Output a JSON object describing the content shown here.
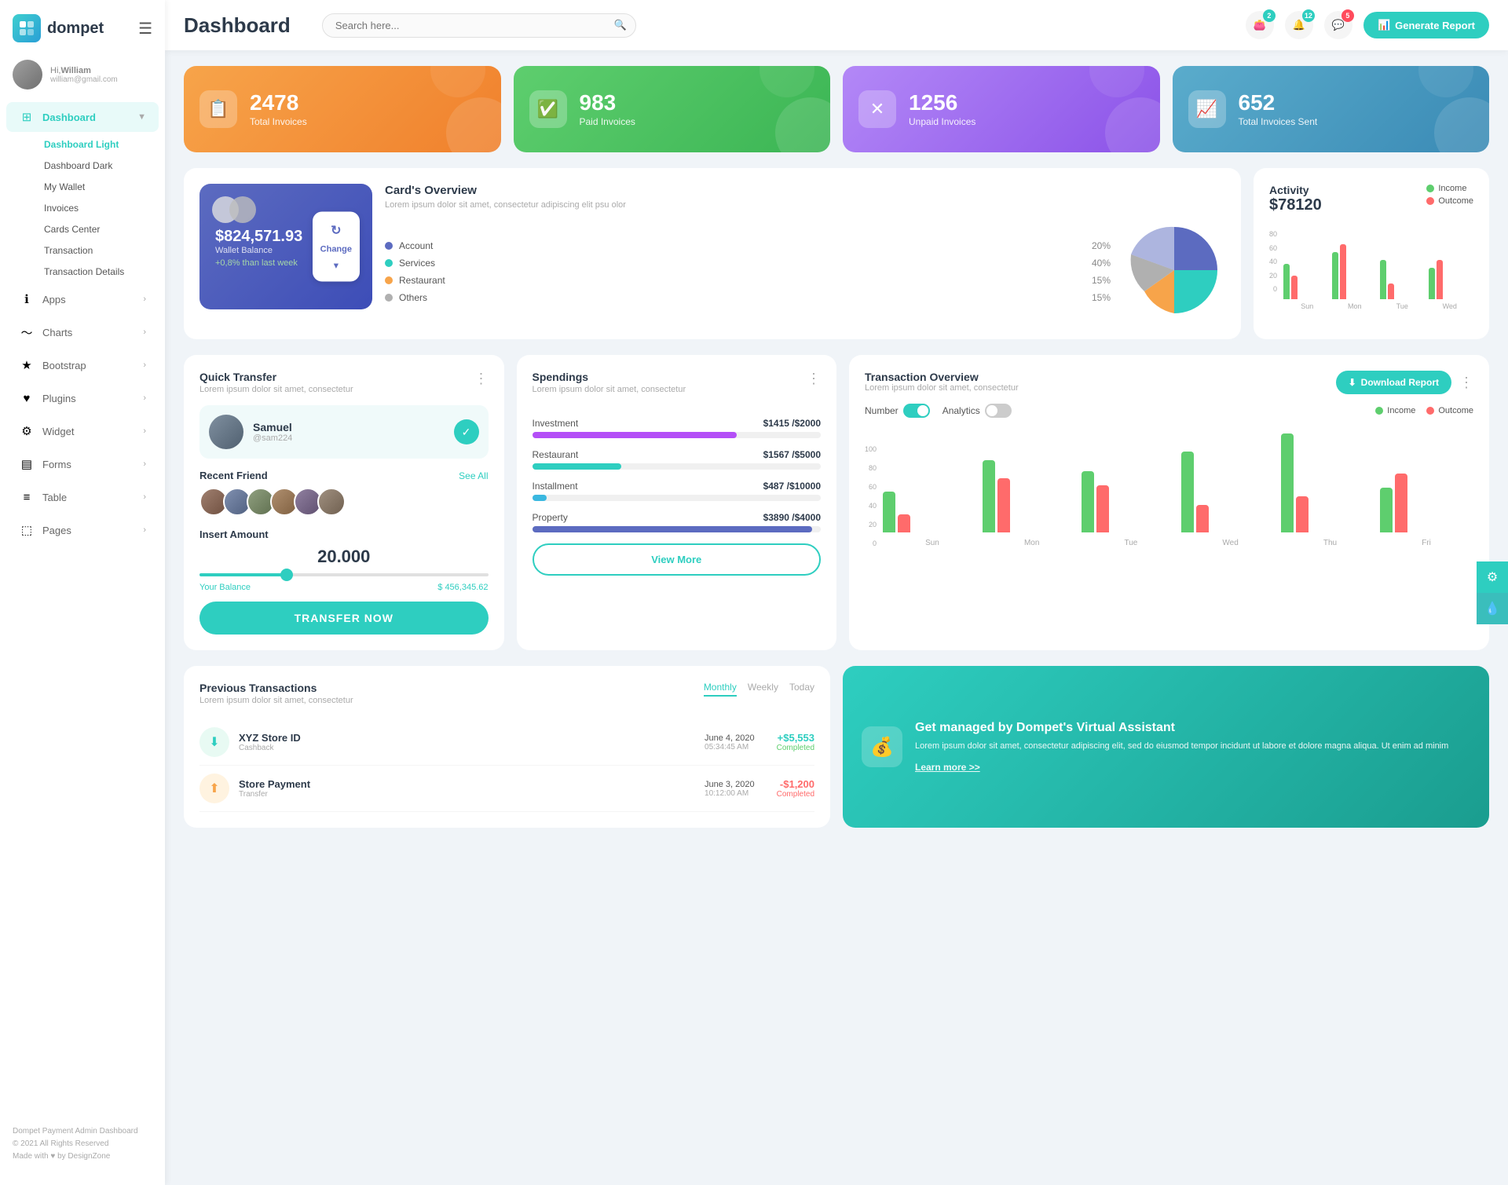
{
  "app": {
    "name": "dompet",
    "title": "Dashboard"
  },
  "header": {
    "search_placeholder": "Search here...",
    "generate_btn": "Generate Report",
    "notifications": {
      "wallet_count": "2",
      "bell_count": "12",
      "chat_count": "5"
    }
  },
  "user": {
    "greeting": "Hi,",
    "name": "William",
    "email": "william@gmail.com"
  },
  "sidebar": {
    "nav_items": [
      {
        "id": "dashboard",
        "label": "Dashboard",
        "icon": "⊞",
        "active": true,
        "has_arrow": true
      },
      {
        "id": "apps",
        "label": "Apps",
        "icon": "ℹ",
        "has_arrow": true
      },
      {
        "id": "charts",
        "label": "Charts",
        "icon": "〜",
        "has_arrow": true
      },
      {
        "id": "bootstrap",
        "label": "Bootstrap",
        "icon": "★",
        "has_arrow": true
      },
      {
        "id": "plugins",
        "label": "Plugins",
        "icon": "♥",
        "has_arrow": true
      },
      {
        "id": "widget",
        "label": "Widget",
        "icon": "⚙",
        "has_arrow": true
      },
      {
        "id": "forms",
        "label": "Forms",
        "icon": "▤",
        "has_arrow": true
      },
      {
        "id": "table",
        "label": "Table",
        "icon": "≡",
        "has_arrow": true
      },
      {
        "id": "pages",
        "label": "Pages",
        "icon": "⬚",
        "has_arrow": true
      }
    ],
    "sub_items": [
      "Dashboard Light",
      "Dashboard Dark",
      "My Wallet",
      "Invoices",
      "Cards Center",
      "Transaction",
      "Transaction Details"
    ],
    "footer_title": "Dompet Payment Admin Dashboard",
    "footer_copy": "© 2021 All Rights Reserved",
    "footer_made": "Made with ♥ by DesignZone"
  },
  "stat_cards": [
    {
      "id": "total-invoices",
      "number": "2478",
      "label": "Total Invoices",
      "icon": "📋",
      "class": "stat-card-orange"
    },
    {
      "id": "paid-invoices",
      "number": "983",
      "label": "Paid Invoices",
      "icon": "✅",
      "class": "stat-card-green"
    },
    {
      "id": "unpaid-invoices",
      "number": "1256",
      "label": "Unpaid Invoices",
      "icon": "✗",
      "class": "stat-card-purple"
    },
    {
      "id": "total-sent",
      "number": "652",
      "label": "Total Invoices Sent",
      "icon": "📊",
      "class": "stat-card-blue"
    }
  ],
  "wallet": {
    "balance": "$824,571.93",
    "label": "Wallet Balance",
    "change": "+0,8% than last week",
    "change_btn": "Change"
  },
  "cards_overview": {
    "title": "Card's Overview",
    "desc": "Lorem ipsum dolor sit amet, consectetur adipiscing elit psu olor",
    "items": [
      {
        "label": "Account",
        "pct": "20%",
        "color": "#5c6bc0"
      },
      {
        "label": "Services",
        "pct": "40%",
        "color": "#2ecec0"
      },
      {
        "label": "Restaurant",
        "pct": "15%",
        "color": "#f7a44a"
      },
      {
        "label": "Others",
        "pct": "15%",
        "color": "#b0b0b0"
      }
    ]
  },
  "activity": {
    "title": "Activity",
    "amount": "$78120",
    "income_label": "Income",
    "outcome_label": "Outcome",
    "bars": [
      {
        "day": "Sun",
        "income": 45,
        "outcome": 30
      },
      {
        "day": "Mon",
        "income": 60,
        "outcome": 70
      },
      {
        "day": "Tue",
        "income": 50,
        "outcome": 20
      },
      {
        "day": "Wed",
        "income": 40,
        "outcome": 50
      }
    ],
    "y_labels": [
      "80",
      "60",
      "40",
      "20",
      "0"
    ]
  },
  "quick_transfer": {
    "title": "Quick Transfer",
    "desc": "Lorem ipsum dolor sit amet, consectetur",
    "contact_name": "Samuel",
    "contact_id": "@sam224",
    "recent_label": "Recent Friend",
    "see_all": "See All",
    "insert_label": "Insert Amount",
    "amount": "20.000",
    "balance_label": "Your Balance",
    "balance_amount": "$ 456,345.62",
    "transfer_btn": "TRANSFER NOW"
  },
  "spendings": {
    "title": "Spendings",
    "desc": "Lorem ipsum dolor sit amet, consectetur",
    "items": [
      {
        "label": "Investment",
        "amount": "$1415",
        "max": "$2000",
        "pct": 71,
        "color": "#b44ff7"
      },
      {
        "label": "Restaurant",
        "amount": "$1567",
        "max": "$5000",
        "pct": 31,
        "color": "#2ecec0"
      },
      {
        "label": "Installment",
        "amount": "$487",
        "max": "$10000",
        "pct": 5,
        "color": "#3ab8e0"
      },
      {
        "label": "Property",
        "amount": "$3890",
        "max": "$4000",
        "pct": 97,
        "color": "#5c6bc0"
      }
    ],
    "view_more": "View More"
  },
  "transaction_overview": {
    "title": "Transaction Overview",
    "desc": "Lorem ipsum dolor sit amet, consectetur",
    "download_btn": "Download Report",
    "number_label": "Number",
    "analytics_label": "Analytics",
    "income_label": "Income",
    "outcome_label": "Outcome",
    "y_labels": [
      "100",
      "80",
      "60",
      "40",
      "20",
      "0"
    ],
    "bars": [
      {
        "day": "Sun",
        "income": 45,
        "outcome": 20
      },
      {
        "day": "Mon",
        "income": 80,
        "outcome": 60
      },
      {
        "day": "Tue",
        "income": 68,
        "outcome": 52
      },
      {
        "day": "Wed",
        "income": 90,
        "outcome": 30
      },
      {
        "day": "Thu",
        "income": 110,
        "outcome": 40
      },
      {
        "day": "Fri",
        "income": 50,
        "outcome": 65
      }
    ]
  },
  "previous_transactions": {
    "title": "Previous Transactions",
    "desc": "Lorem ipsum dolor sit amet, consectetur",
    "tabs": [
      "Monthly",
      "Weekly",
      "Today"
    ],
    "active_tab": "Monthly",
    "items": [
      {
        "name": "XYZ Store ID",
        "sub": "Cashback",
        "date": "June 4, 2020",
        "time": "05:34:45 AM",
        "amount": "+$5,553",
        "status": "Completed"
      }
    ]
  },
  "promo": {
    "title": "Get managed by Dompet's Virtual Assistant",
    "desc": "Lorem ipsum dolor sit amet, consectetur adipiscing elit, sed do eiusmod tempor incidunt ut labore et dolore magna aliqua. Ut enim ad minim",
    "link": "Learn more >>"
  },
  "colors": {
    "teal": "#2ecec0",
    "orange": "#f7a44a",
    "green": "#5ece6e",
    "purple": "#b388f7",
    "blue": "#5aaccc",
    "red": "#ff6b6b"
  }
}
